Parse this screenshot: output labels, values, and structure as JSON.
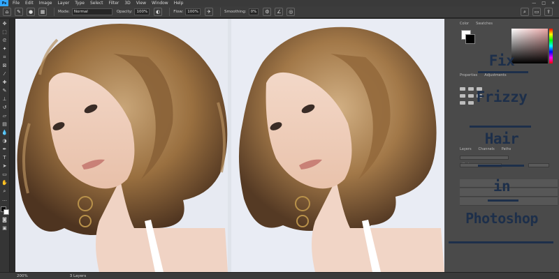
{
  "app": {
    "logo": "Ps"
  },
  "menu": [
    "File",
    "Edit",
    "Image",
    "Layer",
    "Type",
    "Select",
    "Filter",
    "3D",
    "View",
    "Window",
    "Help"
  ],
  "window_controls": [
    "—",
    "□",
    "✕"
  ],
  "options": {
    "mode_label": "Mode:",
    "mode_value": "Normal",
    "opacity_label": "Opacity:",
    "opacity_value": "100%",
    "flow_label": "Flow:",
    "flow_value": "100%",
    "smoothing_label": "Smoothing:",
    "smoothing_value": "0%"
  },
  "status": {
    "zoom": "200%",
    "doc_info": "3 Layers"
  },
  "panels": {
    "color_tabs": [
      "Color",
      "Swatches"
    ],
    "adj_tabs": [
      "Properties",
      "Adjustments"
    ],
    "layers_tabs": [
      "Layers",
      "Channels",
      "Paths"
    ],
    "kind_label": "Kind"
  },
  "title": {
    "lines": [
      "Fix",
      "Frizzy",
      "Hair",
      "in",
      "Photoshop"
    ]
  },
  "colors": {
    "title": "#1d2f4a",
    "accent": "#31a8ff"
  },
  "icons": {
    "home": "home-icon",
    "brush": "brush-icon",
    "settings": "gear-icon",
    "airbrush": "airbrush-icon",
    "search": "search-icon",
    "workspace": "workspace-icon",
    "share": "share-icon"
  }
}
